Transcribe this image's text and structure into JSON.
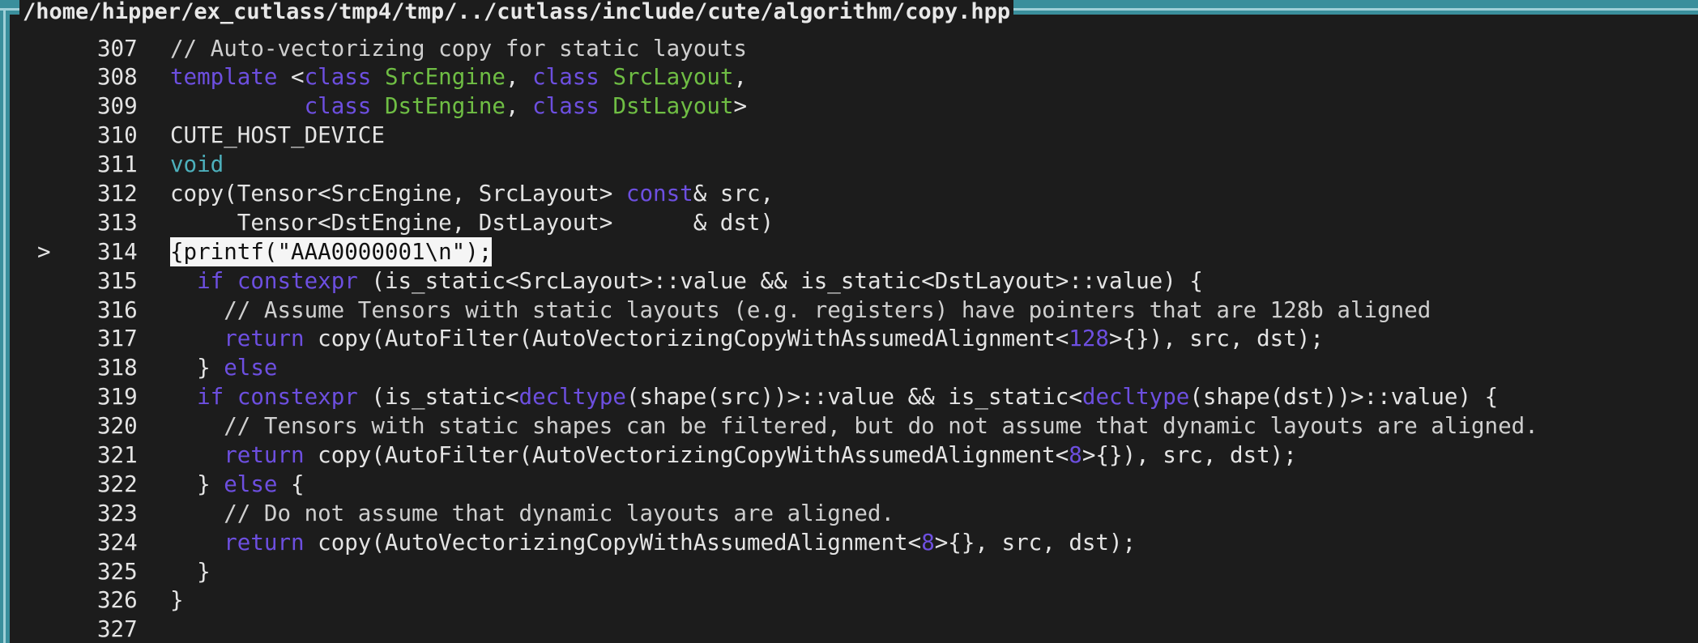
{
  "window": {
    "title": "/home/hipper/ex_cutlass/tmp4/tmp/../cutlass/include/cute/algorithm/copy.hpp",
    "frame_color": "#3a8f9c"
  },
  "current_line_marker": ">",
  "colors": {
    "background": "#1c1c1c",
    "keyword": "#6d4fe0",
    "type": "#4db0bc",
    "class_name": "#6fbe44",
    "text": "#e4e4e4",
    "highlight_bg": "#f5f5f5"
  },
  "lines": [
    {
      "num": "307",
      "marker": "",
      "tokens": [
        {
          "t": "// Auto-vectorizing copy for static layouts",
          "k": "comment"
        }
      ]
    },
    {
      "num": "308",
      "marker": "",
      "tokens": [
        {
          "t": "template",
          "k": "keyword"
        },
        {
          "t": " <",
          "k": "plain"
        },
        {
          "t": "class",
          "k": "keyword"
        },
        {
          "t": " ",
          "k": "plain"
        },
        {
          "t": "SrcEngine",
          "k": "class"
        },
        {
          "t": ", ",
          "k": "plain"
        },
        {
          "t": "class",
          "k": "keyword"
        },
        {
          "t": " ",
          "k": "plain"
        },
        {
          "t": "SrcLayout",
          "k": "class"
        },
        {
          "t": ",",
          "k": "plain"
        }
      ]
    },
    {
      "num": "309",
      "marker": "",
      "tokens": [
        {
          "t": "          ",
          "k": "plain"
        },
        {
          "t": "class",
          "k": "keyword"
        },
        {
          "t": " ",
          "k": "plain"
        },
        {
          "t": "DstEngine",
          "k": "class"
        },
        {
          "t": ", ",
          "k": "plain"
        },
        {
          "t": "class",
          "k": "keyword"
        },
        {
          "t": " ",
          "k": "plain"
        },
        {
          "t": "DstLayout",
          "k": "class"
        },
        {
          "t": ">",
          "k": "plain"
        }
      ]
    },
    {
      "num": "310",
      "marker": "",
      "tokens": [
        {
          "t": "CUTE_HOST_DEVICE",
          "k": "plain"
        }
      ]
    },
    {
      "num": "311",
      "marker": "",
      "tokens": [
        {
          "t": "void",
          "k": "type"
        }
      ]
    },
    {
      "num": "312",
      "marker": "",
      "tokens": [
        {
          "t": "copy(Tensor<SrcEngine, SrcLayout> ",
          "k": "plain"
        },
        {
          "t": "const",
          "k": "keyword"
        },
        {
          "t": "& src,",
          "k": "plain"
        }
      ]
    },
    {
      "num": "313",
      "marker": "",
      "tokens": [
        {
          "t": "     Tensor<DstEngine, DstLayout>      & dst)",
          "k": "plain"
        }
      ]
    },
    {
      "num": "314",
      "marker": ">",
      "highlight": true,
      "tokens": [
        {
          "t": "{printf(\"AAA0000001\\n\");",
          "k": "plain"
        }
      ]
    },
    {
      "num": "315",
      "marker": "",
      "tokens": [
        {
          "t": "  ",
          "k": "plain"
        },
        {
          "t": "if",
          "k": "keyword"
        },
        {
          "t": " ",
          "k": "plain"
        },
        {
          "t": "constexpr",
          "k": "keyword"
        },
        {
          "t": " (is_static<SrcLayout>::value && is_static<DstLayout>::value) {",
          "k": "plain"
        }
      ]
    },
    {
      "num": "316",
      "marker": "",
      "tokens": [
        {
          "t": "    // Assume Tensors with static layouts (e.g. registers) have pointers that are 128b aligned",
          "k": "comment"
        }
      ]
    },
    {
      "num": "317",
      "marker": "",
      "tokens": [
        {
          "t": "    ",
          "k": "plain"
        },
        {
          "t": "return",
          "k": "keyword"
        },
        {
          "t": " copy(AutoFilter(AutoVectorizingCopyWithAssumedAlignment<",
          "k": "plain"
        },
        {
          "t": "128",
          "k": "number"
        },
        {
          "t": ">{}), src, dst);",
          "k": "plain"
        }
      ]
    },
    {
      "num": "318",
      "marker": "",
      "tokens": [
        {
          "t": "  } ",
          "k": "plain"
        },
        {
          "t": "else",
          "k": "keyword"
        }
      ]
    },
    {
      "num": "319",
      "marker": "",
      "tokens": [
        {
          "t": "  ",
          "k": "plain"
        },
        {
          "t": "if",
          "k": "keyword"
        },
        {
          "t": " ",
          "k": "plain"
        },
        {
          "t": "constexpr",
          "k": "keyword"
        },
        {
          "t": " (is_static<",
          "k": "plain"
        },
        {
          "t": "decltype",
          "k": "keyword"
        },
        {
          "t": "(shape(src))>::value && is_static<",
          "k": "plain"
        },
        {
          "t": "decltype",
          "k": "keyword"
        },
        {
          "t": "(shape(dst))>::value) {",
          "k": "plain"
        }
      ]
    },
    {
      "num": "320",
      "marker": "",
      "tokens": [
        {
          "t": "    // Tensors with static shapes can be filtered, but do not assume that dynamic layouts are aligned.",
          "k": "comment"
        }
      ]
    },
    {
      "num": "321",
      "marker": "",
      "tokens": [
        {
          "t": "    ",
          "k": "plain"
        },
        {
          "t": "return",
          "k": "keyword"
        },
        {
          "t": " copy(AutoFilter(AutoVectorizingCopyWithAssumedAlignment<",
          "k": "plain"
        },
        {
          "t": "8",
          "k": "number"
        },
        {
          "t": ">{}), src, dst);",
          "k": "plain"
        }
      ]
    },
    {
      "num": "322",
      "marker": "",
      "tokens": [
        {
          "t": "  } ",
          "k": "plain"
        },
        {
          "t": "else",
          "k": "keyword"
        },
        {
          "t": " {",
          "k": "plain"
        }
      ]
    },
    {
      "num": "323",
      "marker": "",
      "tokens": [
        {
          "t": "    // Do not assume that dynamic layouts are aligned.",
          "k": "comment"
        }
      ]
    },
    {
      "num": "324",
      "marker": "",
      "tokens": [
        {
          "t": "    ",
          "k": "plain"
        },
        {
          "t": "return",
          "k": "keyword"
        },
        {
          "t": " copy(AutoVectorizingCopyWithAssumedAlignment<",
          "k": "plain"
        },
        {
          "t": "8",
          "k": "number"
        },
        {
          "t": ">{}, src, dst);",
          "k": "plain"
        }
      ]
    },
    {
      "num": "325",
      "marker": "",
      "tokens": [
        {
          "t": "  }",
          "k": "plain"
        }
      ]
    },
    {
      "num": "326",
      "marker": "",
      "tokens": [
        {
          "t": "}",
          "k": "plain"
        }
      ]
    },
    {
      "num": "327",
      "marker": "",
      "tokens": []
    }
  ]
}
